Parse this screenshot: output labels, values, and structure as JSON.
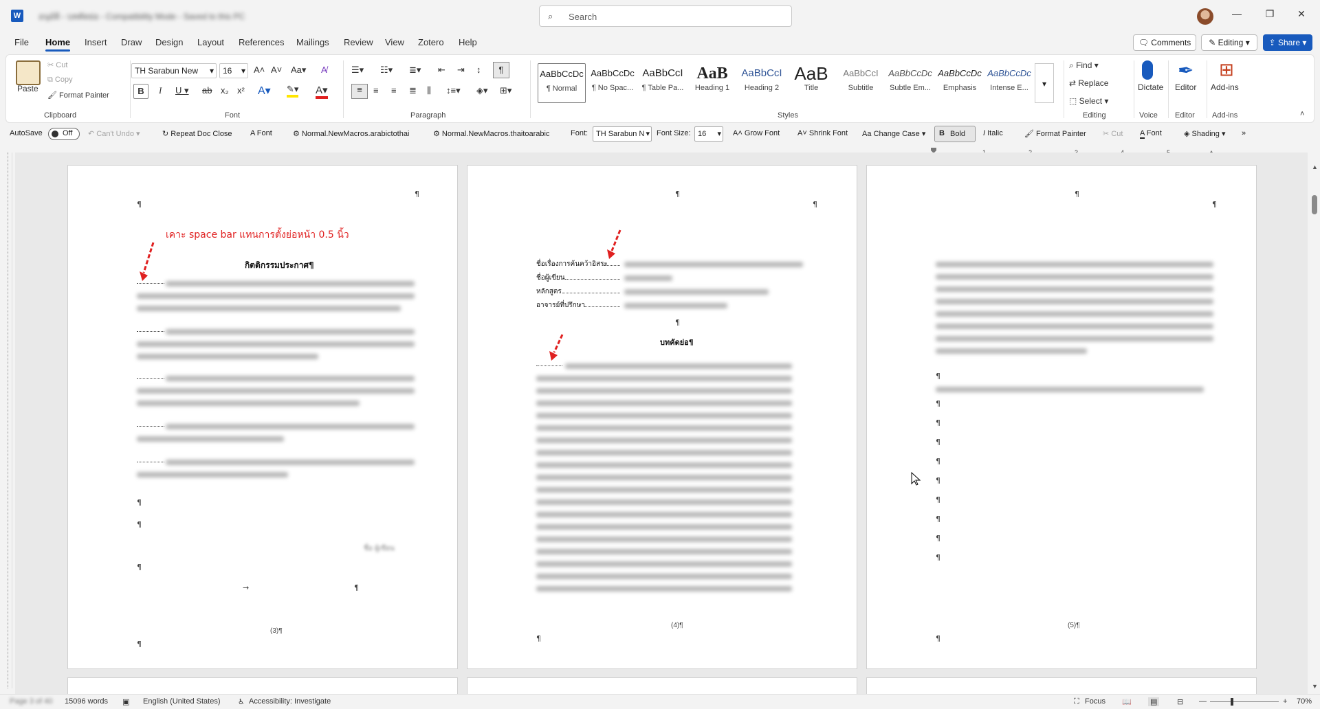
{
  "titlebar": {
    "doc_title": "อนุมัติ - บทคัดย่อ - Compatibility Mode - Saved to this PC",
    "search_placeholder": "Search",
    "minimize": "—",
    "restore": "❐",
    "close": "✕"
  },
  "menu": {
    "tabs": [
      "File",
      "Home",
      "Insert",
      "Draw",
      "Design",
      "Layout",
      "References",
      "Mailings",
      "Review",
      "View",
      "Zotero",
      "Help"
    ],
    "active": "Home",
    "comments": "Comments",
    "editing": "Editing",
    "share": "Share"
  },
  "ribbon": {
    "clipboard": {
      "paste": "Paste",
      "cut": "Cut",
      "copy": "Copy",
      "format_painter": "Format Painter",
      "label": "Clipboard"
    },
    "font": {
      "name": "TH Sarabun New",
      "size": "16",
      "label": "Font"
    },
    "paragraph": {
      "label": "Paragraph"
    },
    "styles": {
      "label": "Styles",
      "tiles": [
        {
          "preview": "AaBbCcDc",
          "name": "¶ Normal"
        },
        {
          "preview": "AaBbCcDc",
          "name": "¶ No Spac..."
        },
        {
          "preview": "AaBbCcI",
          "name": "¶ Table Pa..."
        },
        {
          "preview": "AaB",
          "name": "Heading 1"
        },
        {
          "preview": "AaBbCcI",
          "name": "Heading 2"
        },
        {
          "preview": "AaB",
          "name": "Title"
        },
        {
          "preview": "AaBbCcI",
          "name": "Subtitle"
        },
        {
          "preview": "AaBbCcDc",
          "name": "Subtle Em..."
        },
        {
          "preview": "AaBbCcDc",
          "name": "Emphasis"
        },
        {
          "preview": "AaBbCcDc",
          "name": "Intense E..."
        }
      ]
    },
    "editing": {
      "find": "Find",
      "replace": "Replace",
      "select": "Select",
      "label": "Editing"
    },
    "voice": {
      "dictate": "Dictate",
      "label": "Voice"
    },
    "editor": {
      "editor": "Editor",
      "label": "Editor"
    },
    "addins": {
      "addins": "Add-ins",
      "label": "Add-ins"
    }
  },
  "qat": {
    "autosave": "AutoSave",
    "autosave_state": "Off",
    "cant_undo": "Can't Undo",
    "repeat": "Repeat Doc Close",
    "font": "Font",
    "macro1": "Normal.NewMacros.arabictothai",
    "macro2": "Normal.NewMacros.thaitoarabic",
    "font_label": "Font:",
    "font_value": "TH Sarabun N",
    "font_size_label": "Font Size:",
    "font_size_value": "16",
    "grow": "Grow Font",
    "shrink": "Shrink Font",
    "change_case": "Change Case",
    "bold": "Bold",
    "italic": "Italic",
    "format_painter": "Format Painter",
    "cut": "Cut",
    "font2": "Font",
    "shading": "Shading",
    "more": "»"
  },
  "ruler": {
    "ticks": [
      "1",
      "2",
      "3",
      "4",
      "5"
    ]
  },
  "pages": {
    "p1": {
      "annotation": "เคาะ space bar แทนการตั้งย่อหน้า 0.5 นิ้ว",
      "heading": "กิตติกรรมประกาศ¶",
      "signature": "ชื่อ ผู้เขียน",
      "page_number": "(3)¶"
    },
    "p2": {
      "fields": [
        "ชื่อเรื่องการค้นคว้าอิสระ",
        "ชื่อผู้เขียน",
        "หลักสูตร",
        "อาจารย์ที่ปรึกษา"
      ],
      "heading": "บทคัดย่อ¶",
      "page_number": "(4)¶"
    },
    "p3": {
      "page_number": "(5)¶"
    },
    "pilcrow": "¶",
    "tab_arrow": "→"
  },
  "status": {
    "page": "Page 3 of 40",
    "words": "15096 words",
    "language": "English (United States)",
    "accessibility": "Accessibility: Investigate",
    "focus": "Focus",
    "zoom": "70%"
  }
}
